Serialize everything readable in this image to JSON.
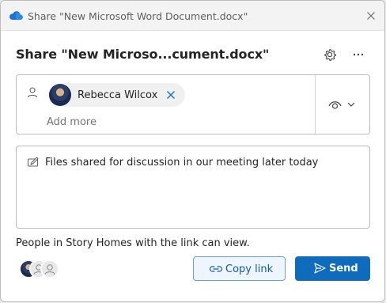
{
  "window": {
    "title": "Share \"New Microsoft Word Document.docx\"",
    "icon": "onedrive-cloud-icon"
  },
  "header": {
    "heading": "Share \"New Microso...cument.docx\"",
    "settings_icon": "gear-icon",
    "more_icon": "more-horizontal-icon"
  },
  "recipients": {
    "people": [
      {
        "name": "Rebecca Wilcox",
        "remove_icon": "close-icon"
      }
    ],
    "add_more_placeholder": "Add more",
    "permission_icon": "eye-icon"
  },
  "message": {
    "text": "Files shared for discussion in our meeting later today"
  },
  "link_info": "People in Story Homes with the link can view.",
  "actions": {
    "copy_link_label": "Copy link",
    "send_label": "Send"
  },
  "colors": {
    "accent": "#0f6cbd",
    "copy_link_text": "#0f5cab",
    "copy_link_border": "#6aa0d6"
  }
}
